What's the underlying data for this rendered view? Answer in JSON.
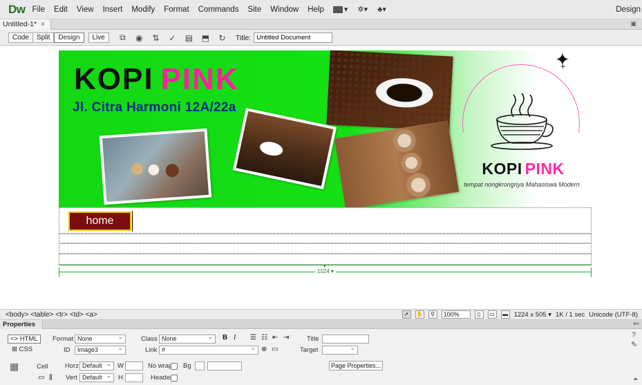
{
  "app": {
    "logo": "Dw",
    "menu": [
      "File",
      "Edit",
      "View",
      "Insert",
      "Modify",
      "Format",
      "Commands",
      "Site",
      "Window",
      "Help"
    ],
    "workspace": "Design"
  },
  "doc_tab": {
    "label": "Untitled-1*",
    "close": "×"
  },
  "toolbar": {
    "views": [
      "Code",
      "Split",
      "Design",
      "Live"
    ],
    "active_view": "Design",
    "title_label": "Title:",
    "title_value": "Untitled Document"
  },
  "banner": {
    "title_a": "KOPI",
    "title_b": "PINK",
    "address": "Jl. Citra Harmoni 12A/22a",
    "logo_name_a": "KOPI",
    "logo_name_b": "PINK",
    "tagline": "tempat nongkrongnya Mahasiswa Modern"
  },
  "nav": {
    "home_label": "home"
  },
  "ruler": {
    "width_label": "1024 ▾"
  },
  "status": {
    "tag_selector": "<body> <table> <tr> <td> <a>",
    "zoom": "100%",
    "window_size": "1224 x 505 ▾",
    "download": "1K / 1 sec",
    "encoding": "Unicode (UTF-8)"
  },
  "properties": {
    "panel_title": "Properties",
    "html_label": "HTML",
    "css_label": "CSS",
    "format_label": "Format",
    "format_value": "None",
    "class_label": "Class",
    "class_value": "None",
    "id_label": "ID",
    "id_value": "Image3",
    "link_label": "Link",
    "link_value": "#",
    "title_label": "Title",
    "target_label": "Target",
    "bold": "B",
    "italic": "I",
    "page_properties": "Page Properties...",
    "cell_label": "Cell",
    "horz_label": "Horz",
    "horz_value": "Default",
    "vert_label": "Vert",
    "vert_value": "Default",
    "w_label": "W",
    "h_label": "H",
    "nowrap_label": "No wrap",
    "bg_label": "Bg",
    "header_label": "Header"
  }
}
